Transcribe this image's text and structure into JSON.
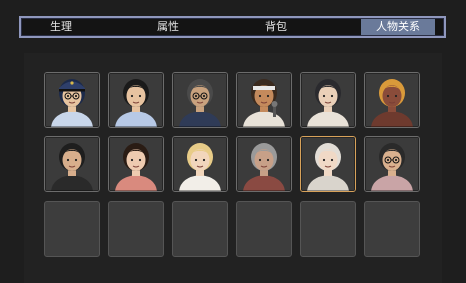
{
  "tabs": [
    {
      "id": "physiology",
      "label": "生理"
    },
    {
      "id": "attributes",
      "label": "属性"
    },
    {
      "id": "backpack",
      "label": "背包"
    },
    {
      "id": "relations",
      "label": "人物关系",
      "active": true
    }
  ],
  "characters": [
    {
      "icon": "police-officer-portrait-icon",
      "hair": "#1c2a4a",
      "skin": "#e6c4a0",
      "shirt": "#c8d6ea",
      "cap": "#2e3f6b",
      "glasses": true
    },
    {
      "icon": "woman-ponytail-portrait-icon",
      "hair": "#1a1a1a",
      "skin": "#e7c3a0",
      "shirt": "#b7c9e6"
    },
    {
      "icon": "old-man-glasses-portrait-icon",
      "hair": "#4a4a4a",
      "skin": "#c9a27e",
      "shirt": "#2f3b57",
      "glasses": true
    },
    {
      "icon": "singer-microphone-portrait-icon",
      "hair": "#3a2a1e",
      "skin": "#c48a5c",
      "shirt": "#e8e2d8",
      "bandana": "#e8e8e8"
    },
    {
      "icon": "bob-hair-woman-portrait-icon",
      "hair": "#2a2a2e",
      "skin": "#ead0b8",
      "shirt": "#e9e2d8"
    },
    {
      "icon": "muscular-man-portrait-icon",
      "hair": "#d99a3a",
      "skin": "#8a4c3a",
      "shirt": "#6e3a2e"
    },
    {
      "icon": "young-man-portrait-icon",
      "hair": "#1e1e1e",
      "skin": "#d7ae8c",
      "shirt": "#2a2a2a"
    },
    {
      "icon": "girl-curly-hair-portrait-icon",
      "hair": "#2a1c14",
      "skin": "#eecbb0",
      "shirt": "#d98a7e"
    },
    {
      "icon": "blonde-woman-portrait-icon",
      "hair": "#e8cc88",
      "skin": "#f2d6bc",
      "shirt": "#f2eee8"
    },
    {
      "icon": "old-woman-portrait-icon",
      "hair": "#9a9a9a",
      "skin": "#c7a088",
      "shirt": "#8a4a42"
    },
    {
      "icon": "white-hair-woman-portrait-icon",
      "hair": "#e2ddd6",
      "skin": "#f0d9c6",
      "shirt": "#d9d4cc",
      "selected": true
    },
    {
      "icon": "man-glasses-portrait-icon",
      "hair": "#2a2a2a",
      "skin": "#d9b08e",
      "shirt": "#c9a4a6",
      "glasses": true
    }
  ],
  "empty_slot_count": 6
}
